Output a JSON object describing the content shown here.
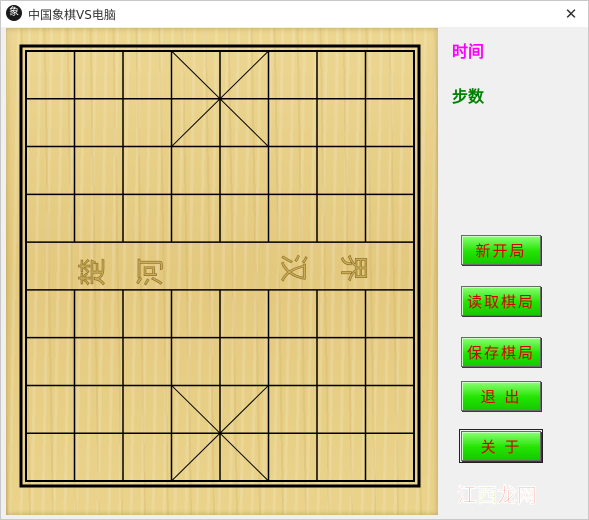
{
  "window": {
    "title": "中国象棋VS电脑",
    "app_icon_glyph": "象",
    "close_glyph": "✕"
  },
  "board": {
    "river_left": [
      "楚",
      "河"
    ],
    "river_right": [
      "汉",
      "界"
    ],
    "line_color": "#000000",
    "wood_color": "#e7cf86"
  },
  "info": {
    "time_label": "时间",
    "steps_label": "步数",
    "time_color": "#ff00ff",
    "steps_color": "#008000"
  },
  "buttons": {
    "new_game": "新开局",
    "load_game": "读取棋局",
    "save_game": "保存棋局",
    "exit": "退 出",
    "about": "关 于",
    "bg_color": "#22e400",
    "text_color": "#d40000"
  },
  "watermark": {
    "part1": "江",
    "part2": "西",
    "part3": "龙网"
  }
}
